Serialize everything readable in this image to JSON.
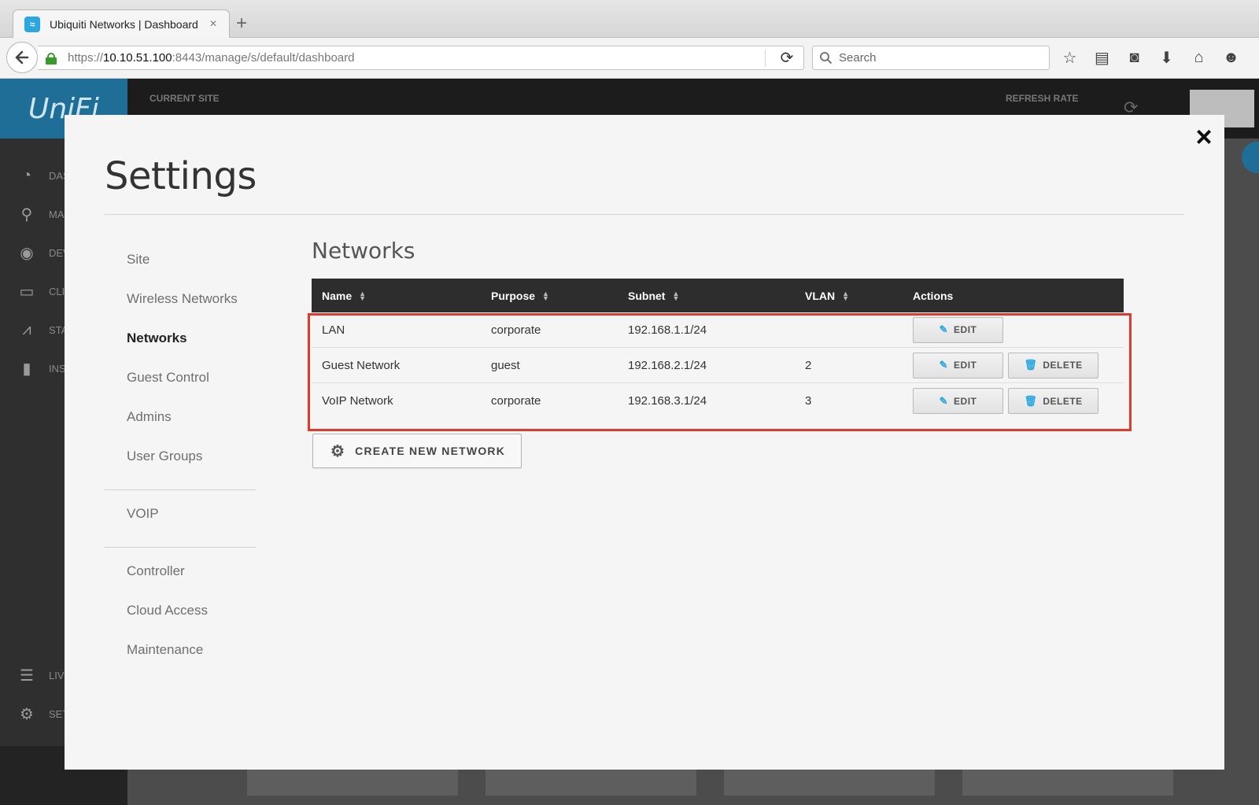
{
  "browser": {
    "tab_title": "Ubiquiti Networks | Dashboard",
    "tab_close": "×",
    "new_tab": "+",
    "url_prefix": "https://",
    "url_host": "10.10.51.100",
    "url_path": ":8443/manage/s/default/dashboard",
    "search_placeholder": "Search",
    "icons": [
      "star-icon",
      "reading-list-icon",
      "pocket-icon",
      "download-icon",
      "home-icon",
      "chat-icon"
    ]
  },
  "app": {
    "logo": "UniFi",
    "current_site_label": "CURRENT SITE",
    "refresh_rate_label": "REFRESH RATE",
    "sidebar_partial": [
      "DAS",
      "MA",
      "DEV",
      "CLI",
      "STA",
      "INS",
      "LIV",
      "SET"
    ]
  },
  "modal": {
    "close": "×",
    "title": "Settings",
    "nav": {
      "group1": [
        "Site",
        "Wireless Networks",
        "Networks",
        "Guest Control",
        "Admins",
        "User Groups"
      ],
      "group2": [
        "VOIP"
      ],
      "group3": [
        "Controller",
        "Cloud Access",
        "Maintenance"
      ],
      "active": "Networks"
    },
    "section_title": "Networks",
    "table": {
      "headers": [
        "Name",
        "Purpose",
        "Subnet",
        "VLAN",
        "Actions"
      ],
      "rows": [
        {
          "name": "LAN",
          "purpose": "corporate",
          "subnet": "192.168.1.1/24",
          "vlan": ""
        },
        {
          "name": "Guest Network",
          "purpose": "guest",
          "subnet": "192.168.2.1/24",
          "vlan": "2"
        },
        {
          "name": "VoIP Network",
          "purpose": "corporate",
          "subnet": "192.168.3.1/24",
          "vlan": "3"
        }
      ],
      "edit_label": "EDIT",
      "delete_label": "DELETE"
    },
    "create_button": "CREATE NEW NETWORK",
    "highlight_color": "#e03a2c"
  }
}
